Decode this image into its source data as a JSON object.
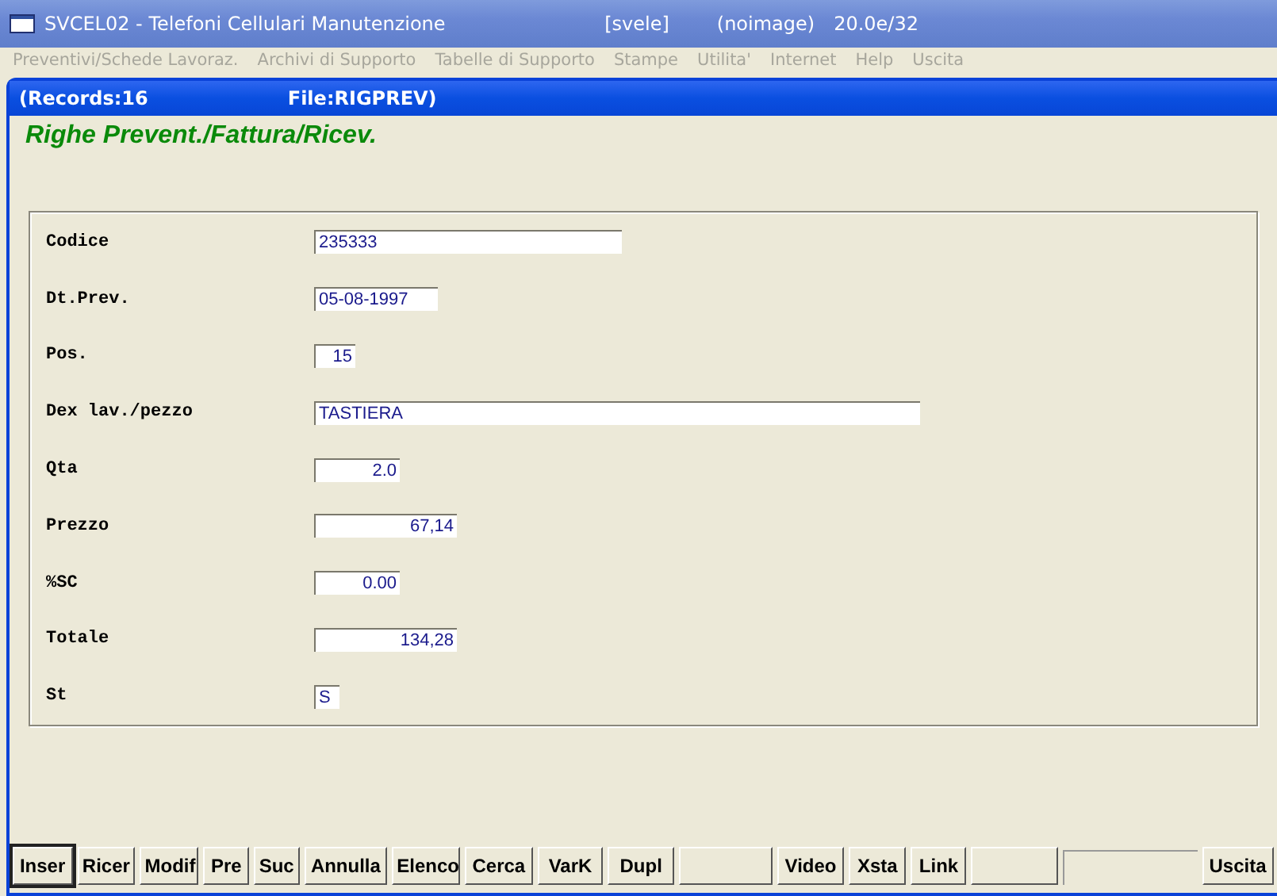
{
  "window": {
    "title": "SVCEL02 - Telefoni Cellulari Manutenzione",
    "user": "[svele]",
    "image": "(noimage)",
    "version": "20.0e/32"
  },
  "menu": [
    {
      "label": "Preventivi/Schede Lavoraz.",
      "disabled": true
    },
    {
      "label": "Archivi di Supporto",
      "disabled": true
    },
    {
      "label": "Tabelle di Supporto",
      "disabled": true
    },
    {
      "label": "Stampe",
      "disabled": true
    },
    {
      "label": "Utilita'",
      "disabled": true
    },
    {
      "label": "Internet",
      "disabled": true
    },
    {
      "label": "Help",
      "disabled": true
    },
    {
      "label": "Uscita",
      "disabled": true
    }
  ],
  "child_window": {
    "records": "(Records:16",
    "file": "File:RIGPREV)"
  },
  "form_title": "Righe Prevent./Fattura/Ricev.",
  "fields": [
    {
      "label": "Codice",
      "value": "235333",
      "right_aligned": false
    },
    {
      "label": "Dt.Prev.",
      "value": "05-08-1997",
      "right_aligned": false
    },
    {
      "label": "Pos.",
      "value": "15",
      "right_aligned": true
    },
    {
      "label": "Dex lav./pezzo",
      "value": "TASTIERA",
      "right_aligned": false
    },
    {
      "label": "Qta",
      "value": "2.0",
      "right_aligned": true
    },
    {
      "label": "Prezzo",
      "value": "67,14",
      "right_aligned": true
    },
    {
      "label": "%SC",
      "value": "0.00",
      "right_aligned": true
    },
    {
      "label": "Totale",
      "value": "134,28",
      "right_aligned": true
    },
    {
      "label": "St",
      "value": "S",
      "right_aligned": false
    }
  ],
  "buttons": [
    {
      "label": "Inser",
      "selected": true
    },
    {
      "label": "Ricer",
      "selected": false
    },
    {
      "label": "Modif",
      "selected": false
    },
    {
      "label": "Pre",
      "selected": false
    },
    {
      "label": "Suc",
      "selected": false
    },
    {
      "label": "Annulla",
      "selected": false
    },
    {
      "label": "Elenco",
      "selected": false
    },
    {
      "label": "Cerca",
      "selected": false
    },
    {
      "label": "VarK",
      "selected": false
    },
    {
      "label": "Dupl",
      "selected": false
    },
    {
      "kind": "blank",
      "selected": false
    },
    {
      "label": "Video",
      "selected": false
    },
    {
      "label": "Xsta",
      "selected": false
    },
    {
      "label": "Link",
      "selected": false
    },
    {
      "kind": "blank",
      "selected": false
    },
    {
      "kind": "spacer"
    },
    {
      "label": "Uscita",
      "selected": false
    }
  ]
}
